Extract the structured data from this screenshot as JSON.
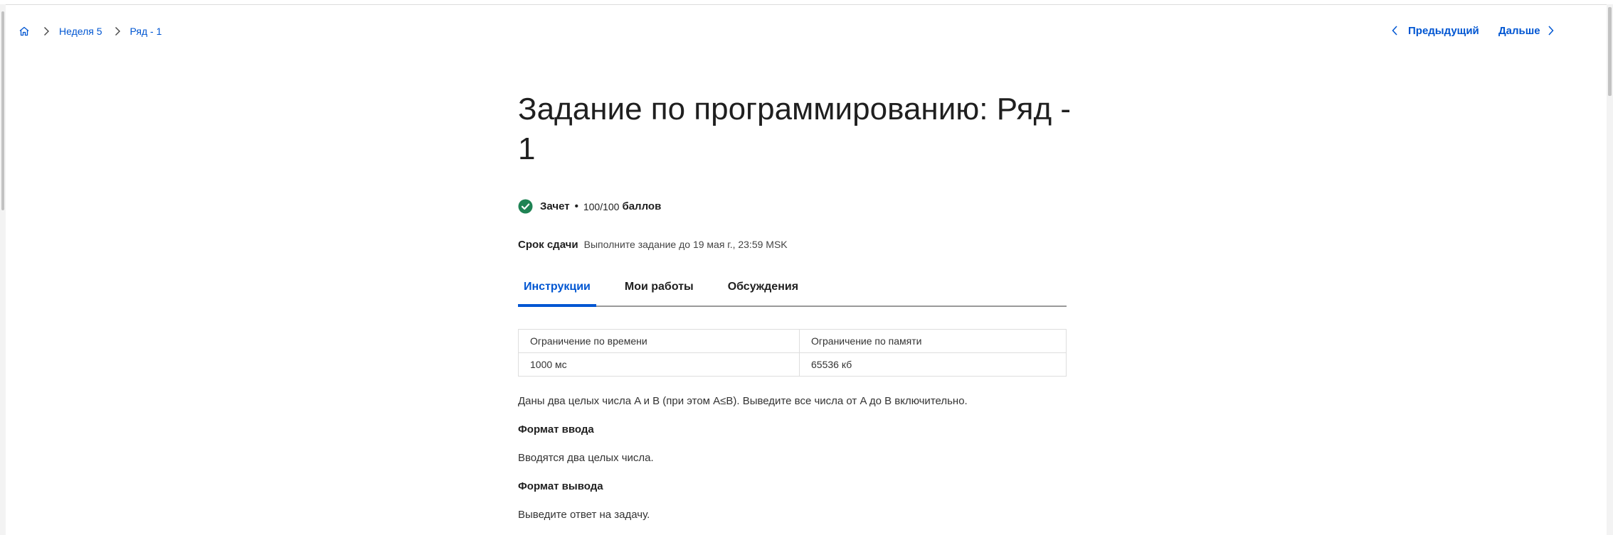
{
  "breadcrumb": {
    "home_icon": "home-icon",
    "items": [
      "Неделя 5",
      "Ряд - 1"
    ]
  },
  "nav": {
    "prev_label": "Предыдущий",
    "next_label": "Дальше"
  },
  "assignment": {
    "title": "Задание по программированию: Ряд - 1",
    "status": {
      "icon": "check-circle-icon",
      "label": "Зачет",
      "separator": "•",
      "score": "100/100",
      "score_unit": "баллов"
    },
    "due": {
      "label": "Срок сдачи",
      "text": "Выполните задание до 19 мая г., 23:59 MSK"
    }
  },
  "tabs": [
    {
      "label": "Инструкции",
      "active": true
    },
    {
      "label": "Мои работы",
      "active": false
    },
    {
      "label": "Обсуждения",
      "active": false
    }
  ],
  "limits": {
    "headers": [
      "Ограничение по времени",
      "Ограничение по памяти"
    ],
    "values": [
      "1000 мс",
      "65536 кб"
    ]
  },
  "instructions": {
    "description": "Даны два целых числа A и B (при этом A≤B). Выведите все числа от A до B включительно.",
    "input_heading": "Формат ввода",
    "input_text": "Вводятся два целых числа.",
    "output_heading": "Формат вывода",
    "output_text": "Выведите ответ на задачу."
  },
  "colors": {
    "accent": "#0056d2",
    "success": "#1f8354"
  }
}
